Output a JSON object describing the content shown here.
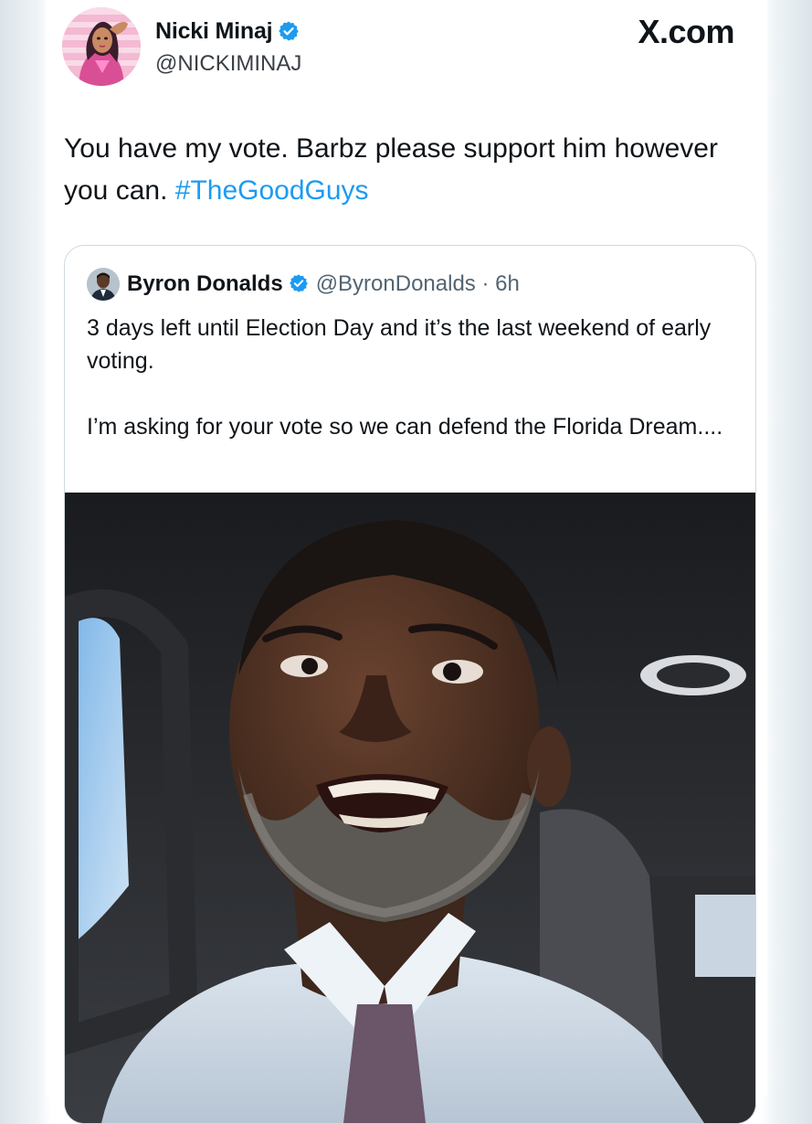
{
  "brand": {
    "site_label": "X.com"
  },
  "tweet": {
    "author_name": "Nicki Minaj",
    "author_handle": "@NICKIMINAJ",
    "text_main": "You have my vote. Barbz please support him however you can.",
    "hashtag": "#TheGoodGuys",
    "avatar_icon": "profile-avatar"
  },
  "quoted_tweet": {
    "author_name": "Byron Donalds",
    "author_handle": "@ByronDonalds",
    "separator": "·",
    "time": "6h",
    "paragraph_1": "3 days left until Election Day and it’s the last weekend of early voting.",
    "paragraph_2": "I’m asking for your vote so we can defend the Florida Dream....",
    "media_icon": "video-thumbnail"
  },
  "colors": {
    "link": "#1d9bf0",
    "verified": "#1d9bf0",
    "text": "#0f1419",
    "secondary_text": "#536471",
    "border": "#cfd9de"
  }
}
